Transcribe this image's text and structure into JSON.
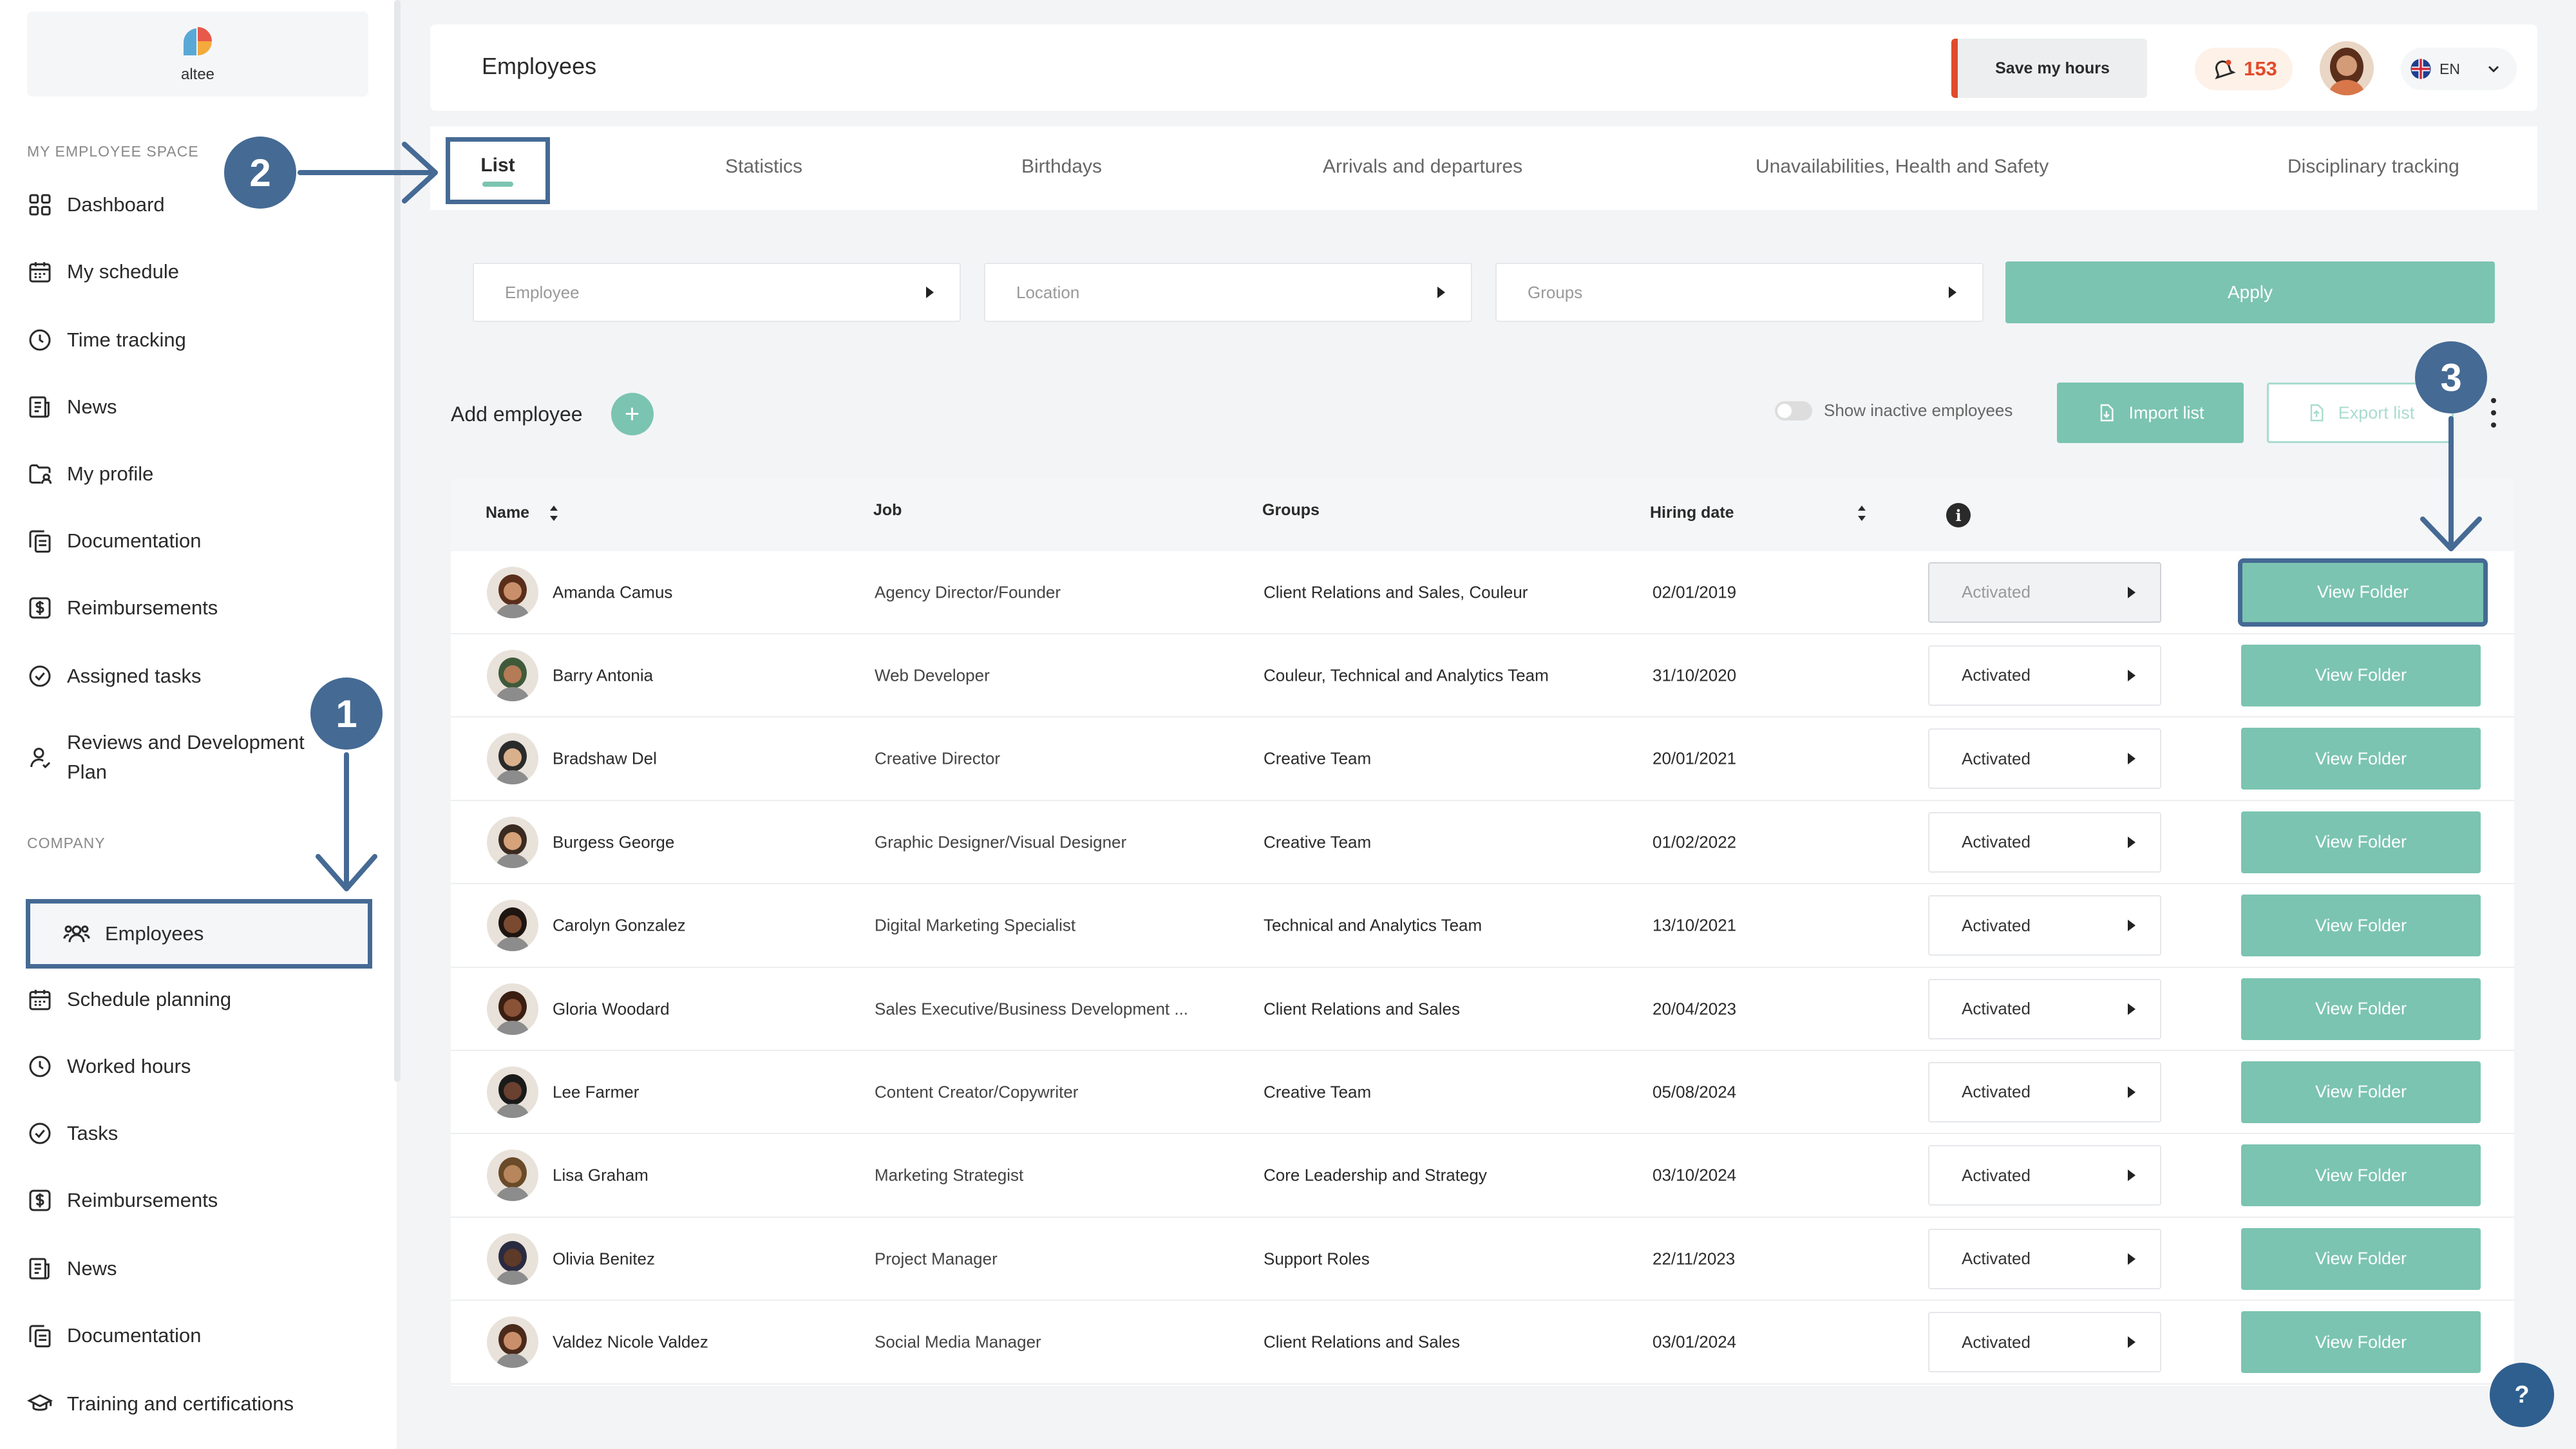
{
  "brand": {
    "name": "altee"
  },
  "sidebar": {
    "section_my_space": "MY EMPLOYEE SPACE",
    "section_company": "COMPANY",
    "my_space_items": [
      {
        "label": "Dashboard",
        "icon": "grid-icon"
      },
      {
        "label": "My schedule",
        "icon": "calendar-icon"
      },
      {
        "label": "Time tracking",
        "icon": "clock-icon"
      },
      {
        "label": "News",
        "icon": "newspaper-icon"
      },
      {
        "label": "My profile",
        "icon": "folder-user-icon"
      },
      {
        "label": "Documentation",
        "icon": "documents-icon"
      },
      {
        "label": "Reimbursements",
        "icon": "dollar-icon"
      },
      {
        "label": "Assigned tasks",
        "icon": "check-circle-icon"
      },
      {
        "label": "Reviews and Development",
        "label2": "Plan",
        "icon": "person-icon"
      }
    ],
    "company_items": [
      {
        "label": "Employees",
        "icon": "people-icon",
        "active": true
      },
      {
        "label": "Schedule planning",
        "icon": "calendar-icon"
      },
      {
        "label": "Worked hours",
        "icon": "clock-icon"
      },
      {
        "label": "Tasks",
        "icon": "check-circle-icon"
      },
      {
        "label": "Reimbursements",
        "icon": "dollar-icon"
      },
      {
        "label": "News",
        "icon": "newspaper-icon"
      },
      {
        "label": "Documentation",
        "icon": "documents-icon"
      },
      {
        "label": "Training and certifications",
        "icon": "graduation-cap-icon"
      }
    ]
  },
  "header": {
    "title": "Employees",
    "save_hours": "Save my hours",
    "notifications": "153",
    "language": "EN"
  },
  "tabs": [
    "List",
    "Statistics",
    "Birthdays",
    "Arrivals and departures",
    "Unavailabilities, Health and Safety",
    "Disciplinary tracking"
  ],
  "filters": {
    "employee_placeholder": "Employee",
    "location_placeholder": "Location",
    "groups_placeholder": "Groups",
    "apply": "Apply"
  },
  "actions": {
    "add_employee": "Add employee",
    "show_inactive": "Show inactive employees",
    "import": "Import list",
    "export": "Export list"
  },
  "table": {
    "columns": {
      "name": "Name",
      "job": "Job",
      "groups": "Groups",
      "hiring_date": "Hiring date"
    },
    "view_label": "View Folder",
    "rows": [
      {
        "name": "Amanda Camus",
        "job": "Agency Director/Founder",
        "groups": "Client Relations and Sales, Couleur",
        "date": "02/01/2019",
        "status": "Activated",
        "skin": "#c98f6b",
        "hair": "#5a2e1a"
      },
      {
        "name": "Barry Antonia",
        "job": "Web Developer",
        "groups": "Couleur, Technical and Analytics Team",
        "date": "31/10/2020",
        "status": "Activated",
        "skin": "#b57a56",
        "hair": "#3f5a3a"
      },
      {
        "name": "Bradshaw Del",
        "job": "Creative Director",
        "groups": "Creative Team",
        "date": "20/01/2021",
        "status": "Activated",
        "skin": "#d9b08c",
        "hair": "#2a2a2a"
      },
      {
        "name": "Burgess George",
        "job": "Graphic Designer/Visual Designer",
        "groups": "Creative Team",
        "date": "01/02/2022",
        "status": "Activated",
        "skin": "#d6a27a",
        "hair": "#3a2a20"
      },
      {
        "name": "Carolyn Gonzalez",
        "job": "Digital Marketing Specialist",
        "groups": "Technical and Analytics Team",
        "date": "13/10/2021",
        "status": "Activated",
        "skin": "#7a4a30",
        "hair": "#1e1410"
      },
      {
        "name": "Gloria Woodard",
        "job": "Sales Executive/Business Development ...",
        "groups": "Client Relations and Sales",
        "date": "20/04/2023",
        "status": "Activated",
        "skin": "#8a5236",
        "hair": "#3a1e12"
      },
      {
        "name": "Lee Farmer",
        "job": "Content Creator/Copywriter",
        "groups": "Creative Team",
        "date": "05/08/2024",
        "status": "Activated",
        "skin": "#6a4030",
        "hair": "#1a1a1a"
      },
      {
        "name": "Lisa Graham",
        "job": "Marketing Strategist",
        "groups": "Core Leadership and Strategy",
        "date": "03/10/2024",
        "status": "Activated",
        "skin": "#b8865c",
        "hair": "#6a4a28"
      },
      {
        "name": "Olivia Benitez",
        "job": "Project Manager",
        "groups": "Support Roles",
        "date": "22/11/2023",
        "status": "Activated",
        "skin": "#5e3a28",
        "hair": "#2a2a40"
      },
      {
        "name": "Valdez Nicole Valdez",
        "job": "Social Media Manager",
        "groups": "Client Relations and Sales",
        "date": "03/01/2024",
        "status": "Activated",
        "skin": "#c98f6b",
        "hair": "#4a2a1a"
      }
    ]
  },
  "annotations": [
    "1",
    "2",
    "3"
  ],
  "help": "?",
  "colors": {
    "accent": "#7bc4b1",
    "highlight": "#456a94",
    "alert": "#e04b2b"
  }
}
